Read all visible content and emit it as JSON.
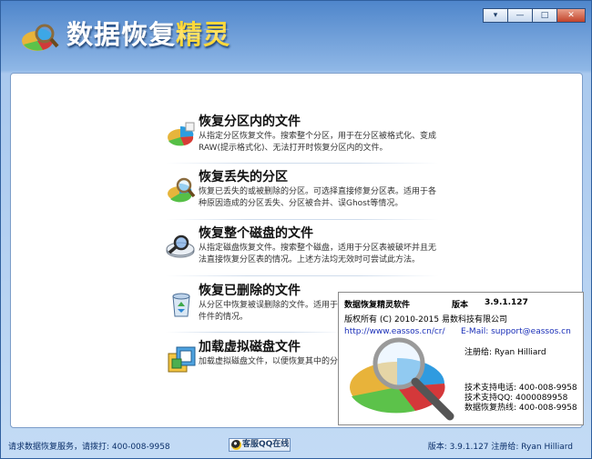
{
  "title": {
    "main": "数据恢复",
    "accent": "精灵"
  },
  "window_buttons": [
    "▾",
    "—",
    "□",
    "✕"
  ],
  "items": [
    {
      "title": "恢复分区内的文件",
      "desc": "从指定分区恢复文件。搜索整个分区，用于在分区被格式化、变成RAW(提示格式化)、无法打开时恢复分区内的文件。",
      "icon": "partition-pie-icon"
    },
    {
      "title": "恢复丢失的分区",
      "desc": "恢复已丢失的或被删除的分区。可选择直接修复分区表。适用于各种原因造成的分区丢失、分区被合并、误Ghost等情况。",
      "icon": "magnifier-pie-icon"
    },
    {
      "title": "恢复整个磁盘的文件",
      "desc": "从指定磁盘恢复文件。搜索整个磁盘，适用于分区表被破坏并且无法直接恢复分区表的情况。上述方法均无效时可尝试此方法。",
      "icon": "disk-magnifier-icon"
    },
    {
      "title": "恢复已删除的文件",
      "desc": "从分区中恢复被误删除的文件。适用于文件件的情况。",
      "icon": "recycle-bin-icon"
    },
    {
      "title": "加载虚拟磁盘文件",
      "desc": "加载虚拟磁盘文件，以便恢复其中的分区",
      "icon": "virtual-disk-icon"
    }
  ],
  "about": {
    "product": "数据恢复精灵软件",
    "version_label": "版本",
    "version": "3.9.1.127",
    "copyright": "版权所有 (C) 2010-2015 易数科技有限公司",
    "url": "http://www.eassos.cn/cr/",
    "email": "E-Mail: support@eassos.cn",
    "registered": "注册给:  Ryan Hilliard",
    "support_phone": "技术支持电话: 400-008-9958",
    "support_qq": "技术支持QQ: 4000089958",
    "hotline": "数据恢复热线: 400-008-9958"
  },
  "status": {
    "left": "请求数据恢复服务，请拨打: 400-008-9958",
    "qq_button": "客服QQ在线",
    "right": "版本: 3.9.1.127  注册给:  Ryan Hilliard"
  }
}
